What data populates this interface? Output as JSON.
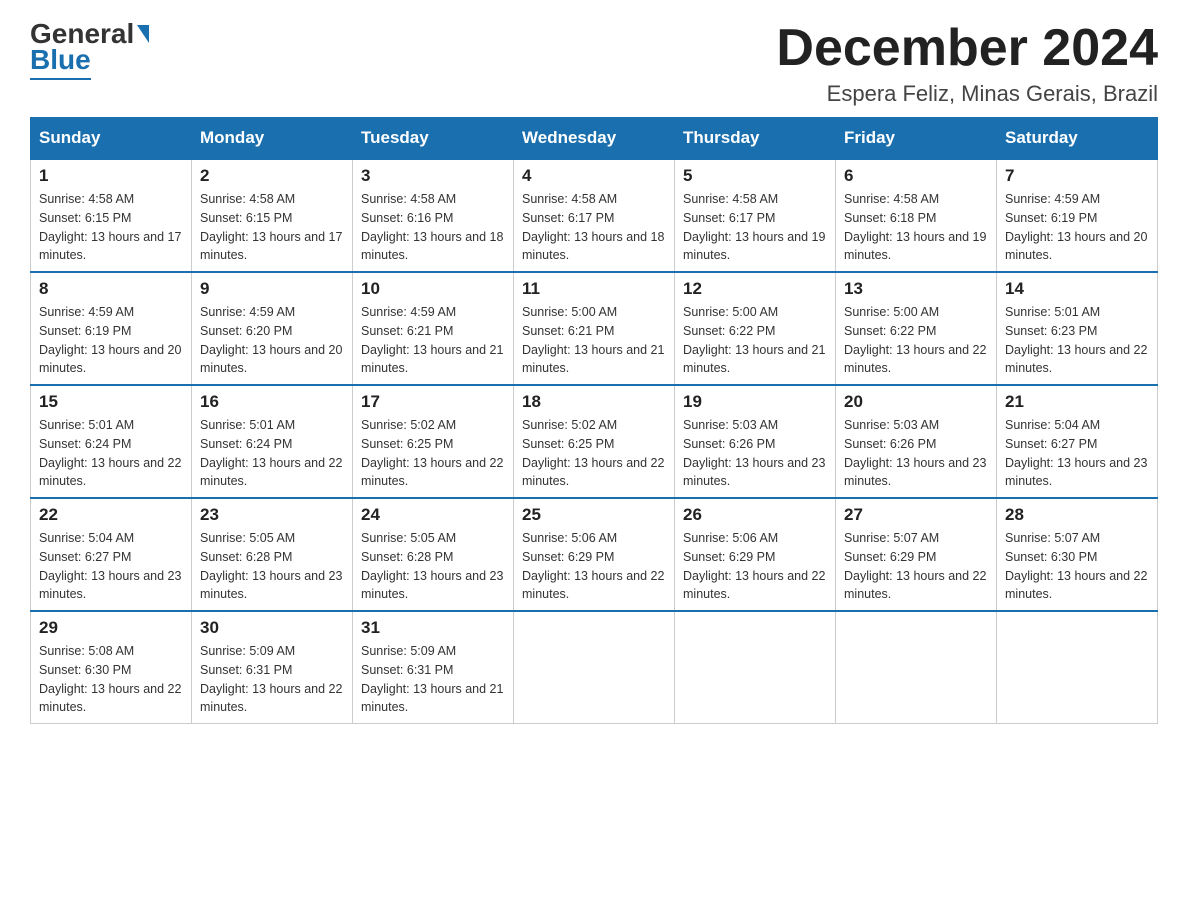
{
  "logo": {
    "line1": "General",
    "arrow": "▶",
    "line2": "Blue"
  },
  "header": {
    "month_title": "December 2024",
    "location": "Espera Feliz, Minas Gerais, Brazil"
  },
  "days_of_week": [
    "Sunday",
    "Monday",
    "Tuesday",
    "Wednesday",
    "Thursday",
    "Friday",
    "Saturday"
  ],
  "weeks": [
    [
      {
        "day": "1",
        "sunrise": "Sunrise: 4:58 AM",
        "sunset": "Sunset: 6:15 PM",
        "daylight": "Daylight: 13 hours and 17 minutes."
      },
      {
        "day": "2",
        "sunrise": "Sunrise: 4:58 AM",
        "sunset": "Sunset: 6:15 PM",
        "daylight": "Daylight: 13 hours and 17 minutes."
      },
      {
        "day": "3",
        "sunrise": "Sunrise: 4:58 AM",
        "sunset": "Sunset: 6:16 PM",
        "daylight": "Daylight: 13 hours and 18 minutes."
      },
      {
        "day": "4",
        "sunrise": "Sunrise: 4:58 AM",
        "sunset": "Sunset: 6:17 PM",
        "daylight": "Daylight: 13 hours and 18 minutes."
      },
      {
        "day": "5",
        "sunrise": "Sunrise: 4:58 AM",
        "sunset": "Sunset: 6:17 PM",
        "daylight": "Daylight: 13 hours and 19 minutes."
      },
      {
        "day": "6",
        "sunrise": "Sunrise: 4:58 AM",
        "sunset": "Sunset: 6:18 PM",
        "daylight": "Daylight: 13 hours and 19 minutes."
      },
      {
        "day": "7",
        "sunrise": "Sunrise: 4:59 AM",
        "sunset": "Sunset: 6:19 PM",
        "daylight": "Daylight: 13 hours and 20 minutes."
      }
    ],
    [
      {
        "day": "8",
        "sunrise": "Sunrise: 4:59 AM",
        "sunset": "Sunset: 6:19 PM",
        "daylight": "Daylight: 13 hours and 20 minutes."
      },
      {
        "day": "9",
        "sunrise": "Sunrise: 4:59 AM",
        "sunset": "Sunset: 6:20 PM",
        "daylight": "Daylight: 13 hours and 20 minutes."
      },
      {
        "day": "10",
        "sunrise": "Sunrise: 4:59 AM",
        "sunset": "Sunset: 6:21 PM",
        "daylight": "Daylight: 13 hours and 21 minutes."
      },
      {
        "day": "11",
        "sunrise": "Sunrise: 5:00 AM",
        "sunset": "Sunset: 6:21 PM",
        "daylight": "Daylight: 13 hours and 21 minutes."
      },
      {
        "day": "12",
        "sunrise": "Sunrise: 5:00 AM",
        "sunset": "Sunset: 6:22 PM",
        "daylight": "Daylight: 13 hours and 21 minutes."
      },
      {
        "day": "13",
        "sunrise": "Sunrise: 5:00 AM",
        "sunset": "Sunset: 6:22 PM",
        "daylight": "Daylight: 13 hours and 22 minutes."
      },
      {
        "day": "14",
        "sunrise": "Sunrise: 5:01 AM",
        "sunset": "Sunset: 6:23 PM",
        "daylight": "Daylight: 13 hours and 22 minutes."
      }
    ],
    [
      {
        "day": "15",
        "sunrise": "Sunrise: 5:01 AM",
        "sunset": "Sunset: 6:24 PM",
        "daylight": "Daylight: 13 hours and 22 minutes."
      },
      {
        "day": "16",
        "sunrise": "Sunrise: 5:01 AM",
        "sunset": "Sunset: 6:24 PM",
        "daylight": "Daylight: 13 hours and 22 minutes."
      },
      {
        "day": "17",
        "sunrise": "Sunrise: 5:02 AM",
        "sunset": "Sunset: 6:25 PM",
        "daylight": "Daylight: 13 hours and 22 minutes."
      },
      {
        "day": "18",
        "sunrise": "Sunrise: 5:02 AM",
        "sunset": "Sunset: 6:25 PM",
        "daylight": "Daylight: 13 hours and 22 minutes."
      },
      {
        "day": "19",
        "sunrise": "Sunrise: 5:03 AM",
        "sunset": "Sunset: 6:26 PM",
        "daylight": "Daylight: 13 hours and 23 minutes."
      },
      {
        "day": "20",
        "sunrise": "Sunrise: 5:03 AM",
        "sunset": "Sunset: 6:26 PM",
        "daylight": "Daylight: 13 hours and 23 minutes."
      },
      {
        "day": "21",
        "sunrise": "Sunrise: 5:04 AM",
        "sunset": "Sunset: 6:27 PM",
        "daylight": "Daylight: 13 hours and 23 minutes."
      }
    ],
    [
      {
        "day": "22",
        "sunrise": "Sunrise: 5:04 AM",
        "sunset": "Sunset: 6:27 PM",
        "daylight": "Daylight: 13 hours and 23 minutes."
      },
      {
        "day": "23",
        "sunrise": "Sunrise: 5:05 AM",
        "sunset": "Sunset: 6:28 PM",
        "daylight": "Daylight: 13 hours and 23 minutes."
      },
      {
        "day": "24",
        "sunrise": "Sunrise: 5:05 AM",
        "sunset": "Sunset: 6:28 PM",
        "daylight": "Daylight: 13 hours and 23 minutes."
      },
      {
        "day": "25",
        "sunrise": "Sunrise: 5:06 AM",
        "sunset": "Sunset: 6:29 PM",
        "daylight": "Daylight: 13 hours and 22 minutes."
      },
      {
        "day": "26",
        "sunrise": "Sunrise: 5:06 AM",
        "sunset": "Sunset: 6:29 PM",
        "daylight": "Daylight: 13 hours and 22 minutes."
      },
      {
        "day": "27",
        "sunrise": "Sunrise: 5:07 AM",
        "sunset": "Sunset: 6:29 PM",
        "daylight": "Daylight: 13 hours and 22 minutes."
      },
      {
        "day": "28",
        "sunrise": "Sunrise: 5:07 AM",
        "sunset": "Sunset: 6:30 PM",
        "daylight": "Daylight: 13 hours and 22 minutes."
      }
    ],
    [
      {
        "day": "29",
        "sunrise": "Sunrise: 5:08 AM",
        "sunset": "Sunset: 6:30 PM",
        "daylight": "Daylight: 13 hours and 22 minutes."
      },
      {
        "day": "30",
        "sunrise": "Sunrise: 5:09 AM",
        "sunset": "Sunset: 6:31 PM",
        "daylight": "Daylight: 13 hours and 22 minutes."
      },
      {
        "day": "31",
        "sunrise": "Sunrise: 5:09 AM",
        "sunset": "Sunset: 6:31 PM",
        "daylight": "Daylight: 13 hours and 21 minutes."
      },
      null,
      null,
      null,
      null
    ]
  ]
}
